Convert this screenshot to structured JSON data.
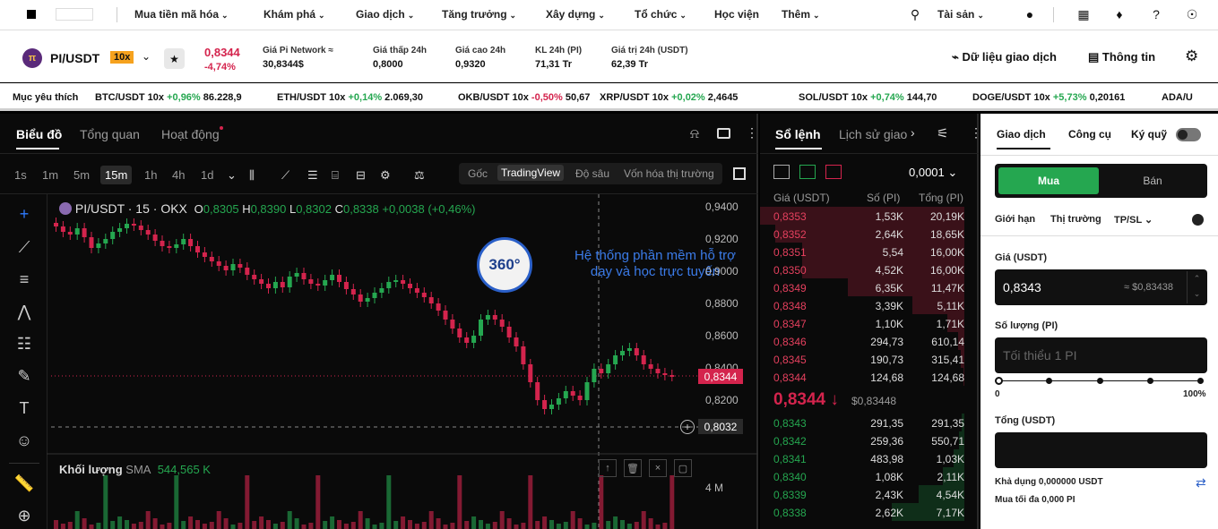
{
  "topnav": {
    "items": [
      "Mua tiền mã hóa",
      "Khám phá",
      "Giao dịch",
      "Tăng trưởng",
      "Xây dựng",
      "Tổ chức",
      "Học viện",
      "Thêm"
    ],
    "assets": "Tài sản"
  },
  "header": {
    "pair": "PI/USDT",
    "leverage": "10x",
    "coin_logo": "π",
    "last_price": "0,8344",
    "change": "-4,74%",
    "stats": [
      {
        "label": "Giá Pi Network ≈",
        "value": "30,8344$"
      },
      {
        "label": "Giá thấp 24h",
        "value": "0,8000"
      },
      {
        "label": "Giá cao 24h",
        "value": "0,9320"
      },
      {
        "label": "KL 24h (PI)",
        "value": "71,31 Tr"
      },
      {
        "label": "Giá trị 24h (USDT)",
        "value": "62,39 Tr"
      }
    ],
    "data_btn": "Dữ liệu giao dịch",
    "info_btn": "Thông tin"
  },
  "marquee": {
    "label": "Mục yêu thích",
    "items": [
      {
        "pair": "BTC/USDT 10x",
        "chg": "+0,96%",
        "price": "86.228,9",
        "dir": "up"
      },
      {
        "pair": "ETH/USDT 10x",
        "chg": "+0,14%",
        "price": "2.069,30",
        "dir": "up"
      },
      {
        "pair": "OKB/USDT 10x",
        "chg": "-0,50%",
        "price": "50,67",
        "dir": "dn"
      },
      {
        "pair": "XRP/USDT 10x",
        "chg": "+0,02%",
        "price": "2,4645",
        "dir": "up"
      },
      {
        "pair": "SOL/USDT 10x",
        "chg": "+0,74%",
        "price": "144,70",
        "dir": "up"
      },
      {
        "pair": "DOGE/USDT 10x",
        "chg": "+5,73%",
        "price": "0,20161",
        "dir": "up"
      },
      {
        "pair": "ADA/U",
        "chg": "",
        "price": "",
        "dir": "up"
      }
    ]
  },
  "chart_tabs": [
    "Biểu đồ",
    "Tổng quan",
    "Hoạt động"
  ],
  "timeframes": [
    "1s",
    "1m",
    "5m",
    "15m",
    "1h",
    "4h",
    "1d"
  ],
  "view_modes": [
    "Gốc",
    "TradingView",
    "Độ sâu",
    "Vốn hóa thị trường"
  ],
  "legend": {
    "title": "PI/USDT · 15 · OKX",
    "o_label": "O",
    "o": "0,8305",
    "h_label": "H",
    "h": "0,8390",
    "l_label": "L",
    "l": "0,8302",
    "c_label": "C",
    "c": "0,8338",
    "chg": "+0,0038 (+0,46%)"
  },
  "yaxis": [
    "0,9400",
    "0,9200",
    "0,9000",
    "0,8800",
    "0,8600",
    "0,8400",
    "0,8200"
  ],
  "price_tag": "0,8344",
  "cross_tag": "0,8032",
  "volume": {
    "label": "Khối lượng",
    "sma": "SMA",
    "value": "544,565 K",
    "axis": "4 M"
  },
  "watermark": {
    "badge": "360°",
    "line1": "Hệ thống phần mềm hỗ trợ",
    "line2": "dạy và học trực tuyến"
  },
  "orderbook": {
    "tabs": [
      "Sổ lệnh",
      "Lịch sử giao"
    ],
    "tick": "0,0001",
    "headers": [
      "Giá (USDT)",
      "Số (PI)",
      "Tổng (PI)"
    ],
    "asks": [
      [
        "0,8353",
        "1,53K",
        "20,19K"
      ],
      [
        "0,8352",
        "2,64K",
        "18,65K"
      ],
      [
        "0,8351",
        "5,54",
        "16,00K"
      ],
      [
        "0,8350",
        "4,52K",
        "16,00K"
      ],
      [
        "0,8349",
        "6,35K",
        "11,47K"
      ],
      [
        "0,8348",
        "3,39K",
        "5,11K"
      ],
      [
        "0,8347",
        "1,10K",
        "1,71K"
      ],
      [
        "0,8346",
        "294,73",
        "610,14"
      ],
      [
        "0,8345",
        "190,73",
        "315,41"
      ],
      [
        "0,8344",
        "124,68",
        "124,68"
      ]
    ],
    "mid_price": "0,8344 ↓",
    "mid_usd": "$0,83448",
    "bids": [
      [
        "0,8343",
        "291,35",
        "291,35"
      ],
      [
        "0,8342",
        "259,36",
        "550,71"
      ],
      [
        "0,8341",
        "483,98",
        "1,03K"
      ],
      [
        "0,8340",
        "1,08K",
        "2,11K"
      ],
      [
        "0,8339",
        "2,43K",
        "4,54K"
      ],
      [
        "0,8338",
        "2,62K",
        "7,17K"
      ]
    ]
  },
  "trade": {
    "tabs": [
      "Giao dịch",
      "Công cụ",
      "Ký quỹ"
    ],
    "buy": "Mua",
    "sell": "Bán",
    "order_types": [
      "Giới hạn",
      "Thị trường",
      "TP/SL"
    ],
    "price_label": "Giá (USDT)",
    "price_value": "0,8343",
    "price_usd": "≈ $0,83438",
    "qty_label": "Số lượng (PI)",
    "qty_placeholder": "Tối thiểu 1 PI",
    "slider_min": "0",
    "slider_max": "100%",
    "total_label": "Tổng (USDT)",
    "available": "Khả dụng 0,000000 USDT",
    "max_buy": "Mua tối đa 0,000 PI"
  },
  "colors": {
    "up": "#25a750",
    "down": "#d4244d",
    "buy_btn": "#25a750"
  }
}
